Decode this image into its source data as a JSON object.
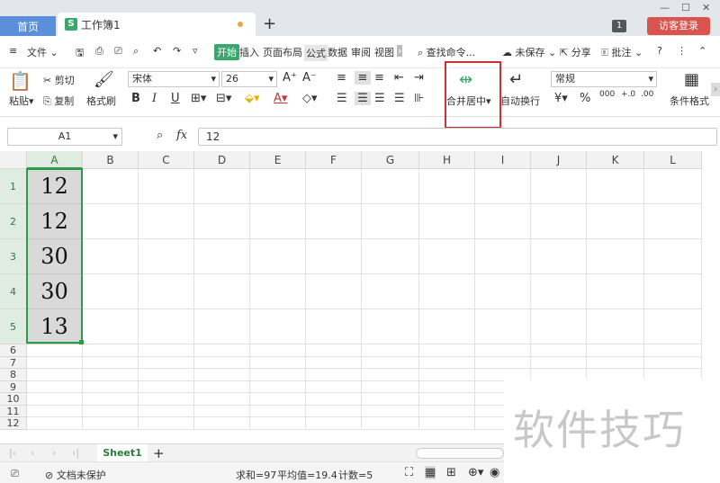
{
  "titlebar": {
    "home_tab": "首页",
    "workbook_tab": "工作簿1",
    "workbook_icon": "S",
    "new_tab": "+",
    "badge": "1",
    "login_button": "访客登录"
  },
  "menu": {
    "file": "文件",
    "items": [
      "开始",
      "插入",
      "页面布局",
      "公式",
      "数据",
      "审阅",
      "视图"
    ],
    "search": "查找命令...",
    "unsaved": "未保存",
    "share": "分享",
    "comment": "批注",
    "help": "?"
  },
  "ribbon": {
    "paste": "粘贴",
    "cut": "剪切",
    "copy": "复制",
    "format_painter": "格式刷",
    "font_name": "宋体",
    "font_size": "26",
    "merge_center": "合并居中",
    "auto_wrap": "自动换行",
    "number_format": "常规",
    "conditional_format": "条件格式"
  },
  "formula_bar": {
    "name_box": "A1",
    "fx": "fx",
    "value": "12"
  },
  "sheet": {
    "columns": [
      "A",
      "B",
      "C",
      "D",
      "E",
      "F",
      "G",
      "H",
      "I",
      "J",
      "K",
      "L"
    ],
    "rows": [
      "1",
      "2",
      "3",
      "4",
      "5",
      "6",
      "7",
      "8",
      "9",
      "10",
      "11",
      "12"
    ],
    "col_a_values": [
      "12",
      "12",
      "30",
      "30",
      "13"
    ]
  },
  "sheet_tabs": {
    "active": "Sheet1",
    "add": "+"
  },
  "status": {
    "protection": "文档未保护",
    "sum": "求和=97",
    "average": "平均值=19.4",
    "count": "计数=5"
  },
  "watermark": "软件技巧",
  "colors": {
    "accent_green": "#3aa76d",
    "selection_green": "#2f9a47",
    "highlight_red": "#d03030",
    "login_red": "#d9534f",
    "home_tab_blue": "#5b8fd9"
  }
}
